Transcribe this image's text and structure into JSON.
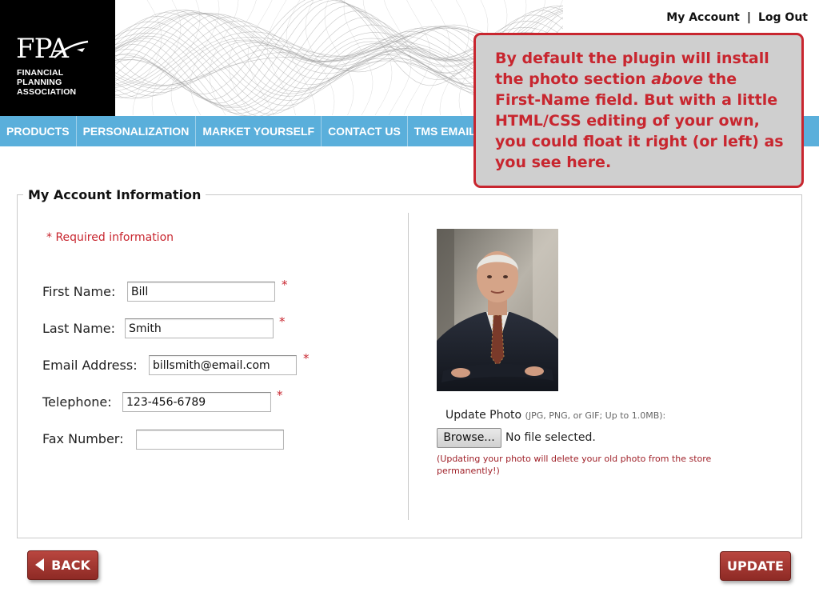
{
  "logo": {
    "mark": "FPA",
    "line1": "FINANCIAL",
    "line2": "PLANNING",
    "line3": "ASSOCIATION"
  },
  "top_links": {
    "my_account": "My Account",
    "separator": "|",
    "log_out": "Log Out"
  },
  "nav": {
    "items": [
      {
        "label": "PRODUCTS"
      },
      {
        "label": "PERSONALIZATION"
      },
      {
        "label": "MARKET YOURSELF"
      },
      {
        "label": "CONTACT US"
      },
      {
        "label": "TMS EMAIL MARKETING"
      }
    ]
  },
  "callout": {
    "part1": "By default the plugin will install the photo section ",
    "emphasis": "above",
    "part2": " the First-Name field. But with a little HTML/CSS editing of your own, you could float it right (or left) as you see here."
  },
  "form": {
    "legend": "My Account Information",
    "required_note": "* Required information",
    "required_marker": "*",
    "fields": {
      "first_name": {
        "label": "First Name:",
        "value": "Bill"
      },
      "last_name": {
        "label": "Last Name:",
        "value": "Smith"
      },
      "email": {
        "label": "Email Address:",
        "value": "billsmith@email.com"
      },
      "telephone": {
        "label": "Telephone:",
        "value": "123-456-6789"
      },
      "fax": {
        "label": "Fax Number:",
        "value": ""
      }
    }
  },
  "photo": {
    "update_label": "Update Photo",
    "update_hint": "(JPG, PNG, or GIF; Up to 1.0MB):",
    "browse_label": "Browse...",
    "no_file_text": "No file selected.",
    "warning": "(Updating your photo will delete your old photo from the store permanently!)"
  },
  "buttons": {
    "back": "BACK",
    "update": "UPDATE"
  },
  "colors": {
    "nav_blue": "#5aafdb",
    "accent_red": "#c8262f",
    "button_red": "#a3372f"
  }
}
